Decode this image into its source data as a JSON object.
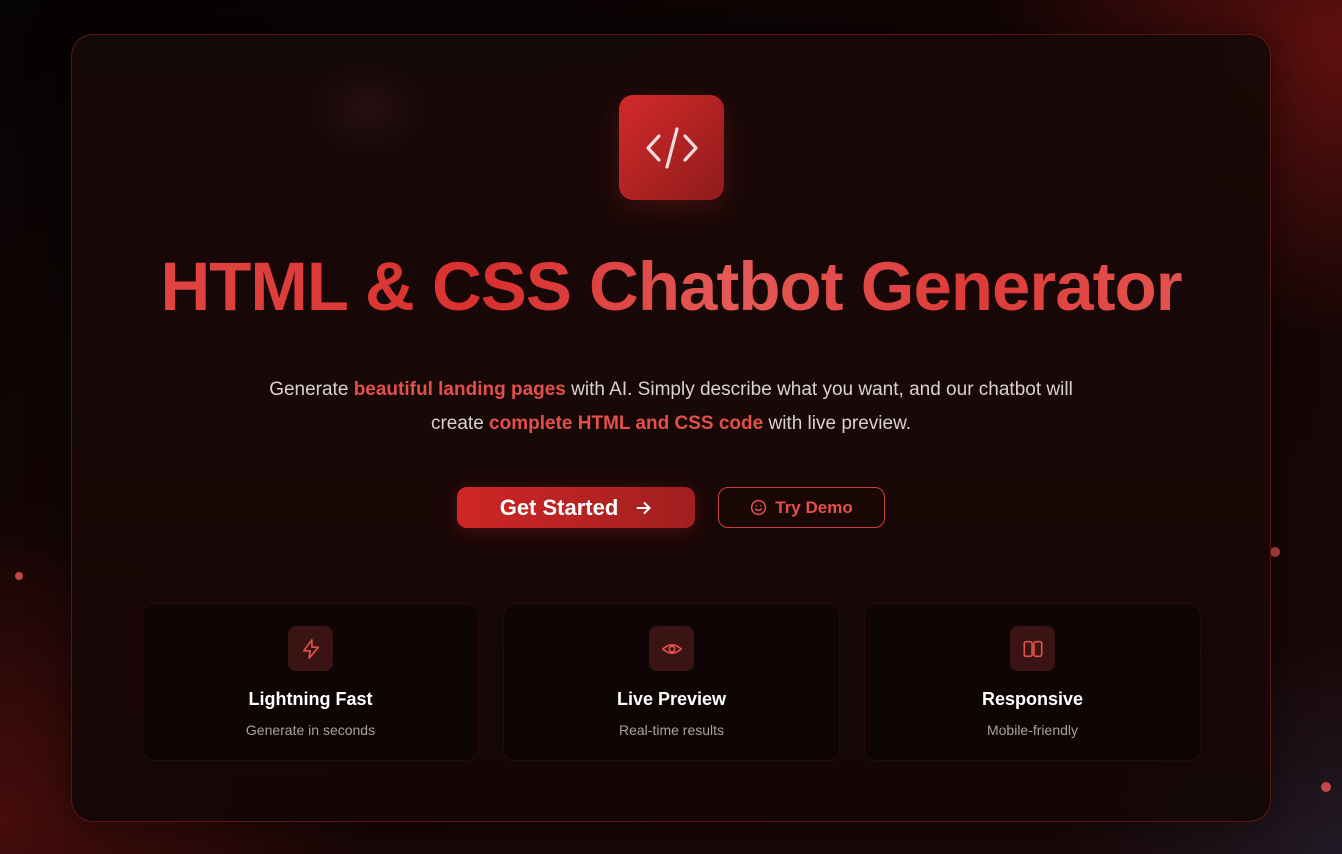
{
  "colors": {
    "accent": "#d4292a",
    "accent_text": "#e2504b",
    "background": "#120505"
  },
  "hero": {
    "logo_icon": "code-icon",
    "title": "HTML & CSS Chatbot Generator",
    "subtitle": {
      "part1": "Generate ",
      "highlight1": "beautiful landing pages",
      "part2": " with AI. Simply describe what you want, and our chatbot will create ",
      "highlight2": "complete HTML and CSS code",
      "part3": " with live preview."
    }
  },
  "actions": {
    "primary_label": "Get Started",
    "primary_icon": "arrow-right-icon",
    "secondary_label": "Try Demo",
    "secondary_icon": "smile-icon"
  },
  "features": [
    {
      "icon": "lightning-icon",
      "title": "Lightning Fast",
      "description": "Generate in seconds"
    },
    {
      "icon": "eye-icon",
      "title": "Live Preview",
      "description": "Real-time results"
    },
    {
      "icon": "columns-icon",
      "title": "Responsive",
      "description": "Mobile-friendly"
    }
  ]
}
